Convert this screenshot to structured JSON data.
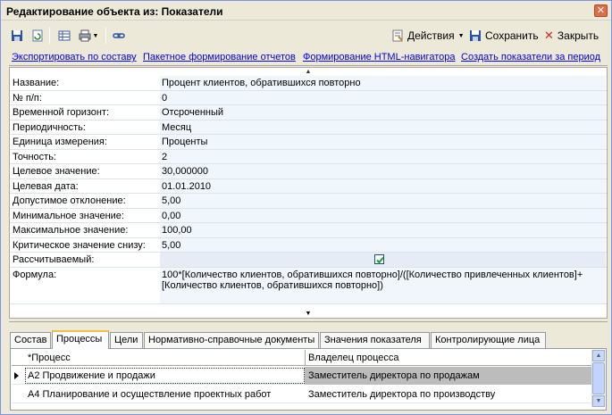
{
  "window": {
    "title": "Редактирование объекта из: Показатели",
    "close_glyph": "✕"
  },
  "toolbar": {
    "actions_label": "Действия",
    "save_label": "Сохранить",
    "close_label": "Закрыть"
  },
  "links": [
    "Экспортировать по составу",
    "Пакетное формирование отчетов",
    "Формирование HTML-навигатора",
    "Создать показатели за период"
  ],
  "properties": [
    {
      "label": "Название:",
      "value": "Процент клиентов, обратившихся повторно"
    },
    {
      "label": "№ п/п:",
      "value": "0"
    },
    {
      "label": "Временной горизонт:",
      "value": "Отсроченный"
    },
    {
      "label": "Периодичность:",
      "value": "Месяц"
    },
    {
      "label": "Единица измерения:",
      "value": "Проценты"
    },
    {
      "label": "Точность:",
      "value": "2"
    },
    {
      "label": "Целевое значение:",
      "value": "30,000000"
    },
    {
      "label": "Целевая дата:",
      "value": "01.01.2010"
    },
    {
      "label": "Допустимое отклонение:",
      "value": "5,00"
    },
    {
      "label": "Минимальное значение:",
      "value": "0,00"
    },
    {
      "label": "Максимальное значение:",
      "value": "100,00"
    },
    {
      "label": "Критическое значение снизу:",
      "value": "5,00"
    }
  ],
  "calculated": {
    "label": "Рассчитываемый:",
    "checked": true
  },
  "formula": {
    "label": "Формула:",
    "value": "100*[Количество клиентов, обратившихся повторно]/([Количество привлеченных клиентов]+[Количество клиентов, обратившихся повторно])"
  },
  "tabs": [
    {
      "label": "Состав",
      "active": false
    },
    {
      "label": "Процессы",
      "active": true
    },
    {
      "label": "Цели",
      "active": false
    },
    {
      "label": "Нормативно-справочные документы",
      "active": false
    },
    {
      "label": "Значения показателя",
      "active": false
    },
    {
      "label": "Контролирующие лица",
      "active": false
    }
  ],
  "table": {
    "columns": [
      "*Процесс",
      "Владелец процесса"
    ],
    "rows": [
      {
        "process": "А2 Продвижение и продажи",
        "owner": "Заместитель директора по продажам",
        "selected": true
      },
      {
        "process": "А4 Планирование и осуществление проектных работ",
        "owner": "Заместитель директора по производству",
        "selected": false
      }
    ]
  },
  "colors": {
    "link": "#0000ee",
    "value_bg": "#f1f6fc",
    "selected_cell": "#bcbcbc",
    "active_tab_accent": "#f7bd4a"
  }
}
